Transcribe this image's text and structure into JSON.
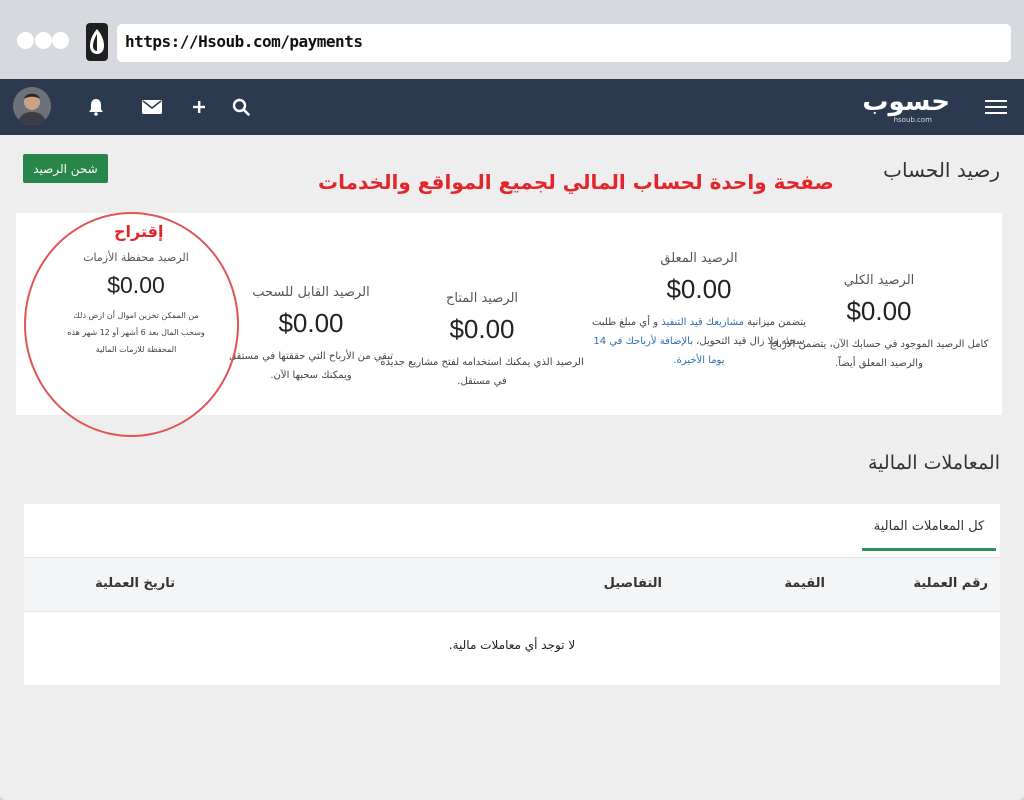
{
  "browser": {
    "url": "https://Hsoub.com/payments"
  },
  "navbar": {
    "brand_name": "حسوب",
    "brand_sub": "hsoub.com",
    "icons": [
      "avatar",
      "bell-icon",
      "envelope-icon",
      "plus-icon",
      "search-icon",
      "hamburger-icon"
    ]
  },
  "header": {
    "title": "رصيد الحساب",
    "charge_button": "شحن الرصيد",
    "promo_text": "صفحة واحدة لحساب المالي لجميع المواقع والخدمات"
  },
  "balances": [
    {
      "label": "الرصيد الكلي",
      "amount": "$0.00",
      "desc_line1": "كامل الرصيد الموجود في حسابك الآن، يتضمن الأرباح",
      "desc_line2": "والرصيد المعلق أيضاً."
    },
    {
      "label": "الرصيد المعلق",
      "amount": "$0.00",
      "desc_line1_pre": "يتضمن ميزانية ",
      "desc_line1_link": "مشاريعك قيد التنفيذ",
      "desc_line1_post": " و أي مبلغ طلبت",
      "desc_line2_pre": "سحبه ولا زال قيد التحويل، ",
      "desc_line2_link": "بالإضافة لأرباحك في 14",
      "desc_line3_link": "يوما الأخيرة."
    },
    {
      "label": "الرصيد المتاح",
      "amount": "$0.00",
      "desc_line1": "الرصيد الذي يمكنك استخدامه لفتح مشاريع جديدة",
      "desc_line2": "في مستقل."
    },
    {
      "label": "الرصيد القابل للسحب",
      "amount": "$0.00",
      "desc_line1": "تبقي من الأرباح التي حققتها في مستقل",
      "desc_line2": "ويمكنك سحبها الآن."
    },
    {
      "label": "الرصيد محفظة الأزمات",
      "amount": "$0.00",
      "desc_line1": "من الممكن تخزين اموال أن ارض ذلك",
      "desc_line2": "وسحب المال بعد 6 أشهر أو 12 شهر هذه",
      "desc_line3": "المحفظة للازمات المالية"
    }
  ],
  "suggestion_label": "إقتراح",
  "transactions": {
    "title": "المعاملات المالية",
    "active_tab": "كل المعاملات المالية",
    "columns": {
      "id": "رقم العملية",
      "value": "القيمة",
      "details": "التفاصيل",
      "date": "تاريخ العملية"
    },
    "empty_message": "لا توجد أي معاملات مالية."
  },
  "colors": {
    "navbar": "#2b3a4f",
    "charge_button": "#28864a",
    "promo": "#e2262b",
    "link": "#2d6fb3",
    "tab_underline": "#2f8f5a"
  }
}
